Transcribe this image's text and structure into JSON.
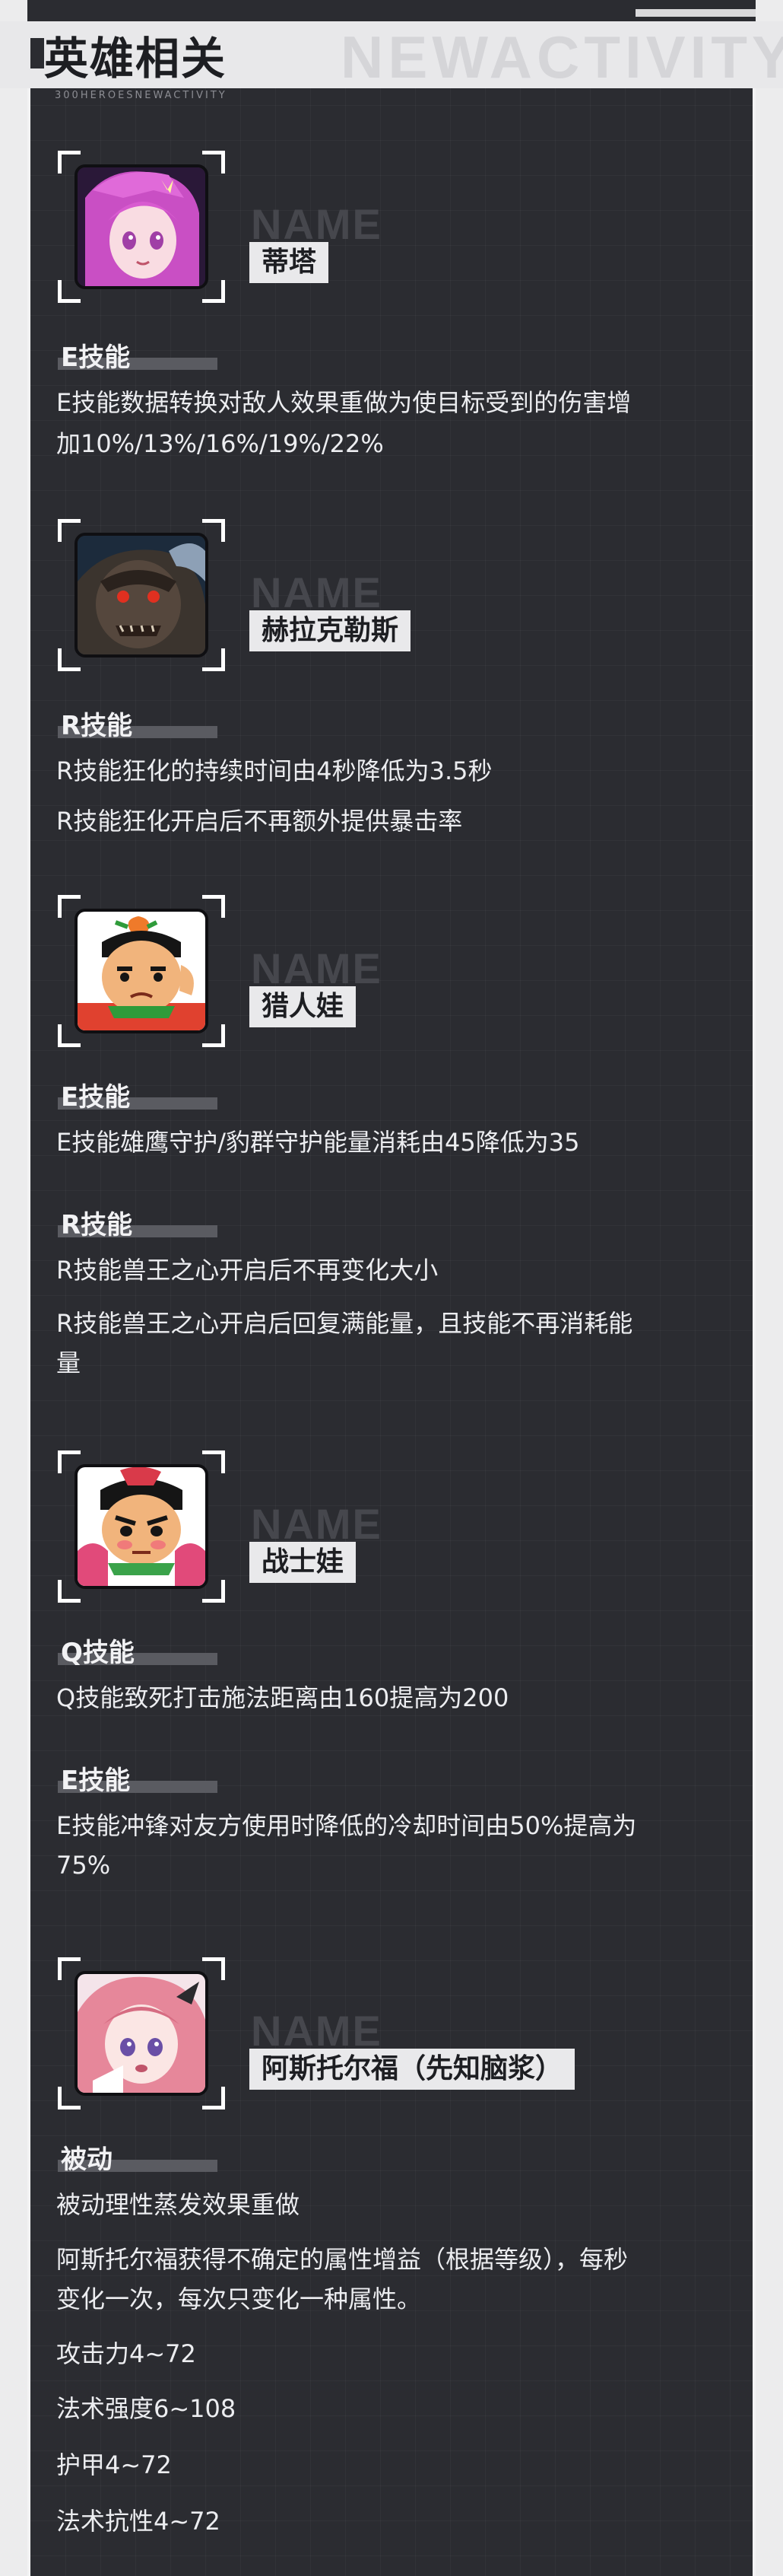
{
  "header": {
    "title": "英雄相关",
    "subtitle": "300HEROESNEWACTIVITY",
    "watermark": "NEWACTIVITY"
  },
  "name_watermark": "NAME",
  "heroes": [
    {
      "name": "蒂塔",
      "portrait_icon": "pink-haired-girl-portrait",
      "skills": [
        {
          "label": "E技能",
          "lines": [
            "E技能数据转换对敌人效果重做为使目标受到的伤害增",
            "加10%/13%/16%/19%/22%"
          ]
        }
      ]
    },
    {
      "name": "赫拉克勒斯",
      "portrait_icon": "dark-giant-portrait",
      "skills": [
        {
          "label": "R技能",
          "lines": [
            "R技能狂化的持续时间由4秒降低为3.5秒",
            "R技能狂化开启后不再额外提供暴击率"
          ]
        }
      ]
    },
    {
      "name": "猎人娃",
      "portrait_icon": "calabash-boy-green-portrait",
      "skills": [
        {
          "label": "E技能",
          "lines": [
            "E技能雄鹰守护/豹群守护能量消耗由45降低为35"
          ]
        },
        {
          "label": "R技能",
          "lines": [
            "R技能兽王之心开启后不再变化大小",
            "R技能兽王之心开启后回复满能量，且技能不再消耗能",
            "量"
          ]
        }
      ]
    },
    {
      "name": "战士娃",
      "portrait_icon": "calabash-boy-red-portrait",
      "skills": [
        {
          "label": "Q技能",
          "lines": [
            "Q技能致死打击施法距离由160提高为200"
          ]
        },
        {
          "label": "E技能",
          "lines": [
            "E技能冲锋对友方使用时降低的冷却时间由50%提高为",
            "75%"
          ]
        }
      ]
    },
    {
      "name": "阿斯托尔福（先知脑浆）",
      "portrait_icon": "pink-haired-knight-portrait",
      "skills": [
        {
          "label": "被动",
          "lines": [
            "被动理性蒸发效果重做",
            "阿斯托尔福获得不确定的属性增益（根据等级），每秒",
            "变化一次，每次只变化一种属性。",
            "攻击力4~72",
            "法术强度6~108",
            "护甲4~72",
            "法术抗性4~72"
          ]
        }
      ]
    }
  ]
}
